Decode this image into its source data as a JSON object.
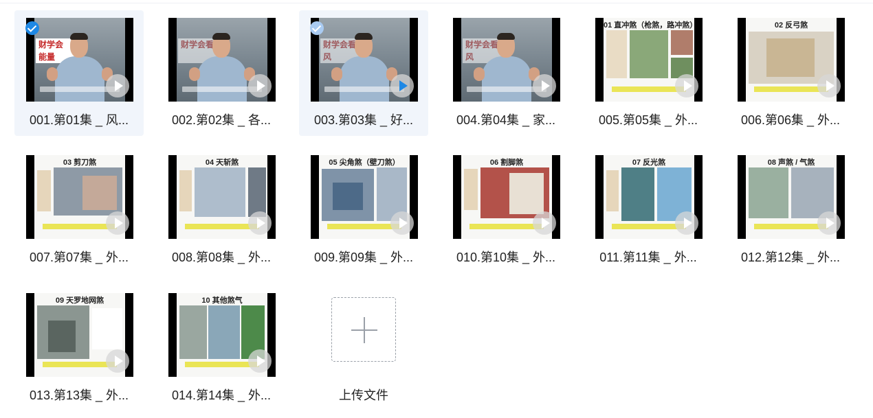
{
  "files": [
    {
      "label": "001.第01集 _ 风...",
      "kind": "video",
      "banner": "财学会\n能量",
      "selected": true,
      "check": "solid"
    },
    {
      "label": "002.第02集 _ 各...",
      "kind": "video",
      "banner": "财学会看",
      "selected": false
    },
    {
      "label": "003.第03集 _ 好...",
      "kind": "video",
      "banner": "财学会看风",
      "selected": true,
      "check": "light",
      "play": "blue"
    },
    {
      "label": "004.第04集 _ 家...",
      "kind": "video",
      "banner": "财学会看风",
      "selected": false
    },
    {
      "label": "005.第05集 _ 外...",
      "kind": "slide",
      "title": "01 直冲煞（枪煞，路冲煞）",
      "selected": false
    },
    {
      "label": "006.第06集 _ 外...",
      "kind": "slide",
      "title": "02 反弓煞",
      "selected": false
    },
    {
      "label": "007.第07集 _ 外...",
      "kind": "slide",
      "title": "03 剪刀煞",
      "selected": false
    },
    {
      "label": "008.第08集 _ 外...",
      "kind": "slide",
      "title": "04 天斩煞",
      "selected": false
    },
    {
      "label": "009.第09集 _ 外...",
      "kind": "slide",
      "title": "05 尖角煞（壁刀煞）",
      "selected": false
    },
    {
      "label": "010.第10集 _ 外...",
      "kind": "slide",
      "title": "06 割脚煞",
      "selected": false
    },
    {
      "label": "011.第11集 _ 外...",
      "kind": "slide",
      "title": "07 反光煞",
      "selected": false
    },
    {
      "label": "012.第12集 _ 外...",
      "kind": "slide",
      "title": "08 声煞 / 气煞",
      "selected": false
    },
    {
      "label": "013.第13集 _ 外...",
      "kind": "slide",
      "title": "09 天罗地网煞",
      "selected": false
    },
    {
      "label": "014.第14集 _ 外...",
      "kind": "slide",
      "title": "10 其他煞气",
      "selected": false
    }
  ],
  "upload": {
    "label": "上传文件",
    "icon": "plus-icon"
  },
  "colors": {
    "accent": "#1e88e5",
    "selected_bg": "#f1f5fb"
  }
}
